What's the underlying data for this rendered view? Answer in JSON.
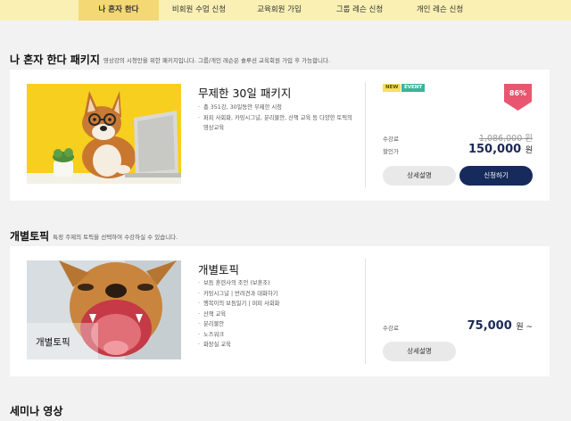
{
  "nav": {
    "tabs": [
      {
        "label": "나 혼자 한다"
      },
      {
        "label": "비회원 수업 신청"
      },
      {
        "label": "교육회원 가입"
      },
      {
        "label": "그룹 레슨 신청"
      },
      {
        "label": "개인 레슨 신청"
      }
    ],
    "active_tab": 0
  },
  "colors": {
    "nav_bg": "#faf0b4",
    "nav_active": "#f3d873",
    "navy": "#162a5b",
    "discount": "#e8566f",
    "badge_new": "#f6e05e",
    "badge_event": "#39b59a"
  },
  "section1": {
    "title": "나 혼자 한다 패키지",
    "subtitle": "영상강의 시청만을 위한 패키지입니다. 그룹/개인 레슨은 솔루션 교육회원 가입 후 가능합니다.",
    "product": {
      "title": "무제한 30일 패키지",
      "features": [
        "총 351강, 30일동안 무제한 시청",
        "퍼피 사회화, 카밍시그널, 분리불안, 산책 교육 등 다양한 토픽의 영상교육"
      ],
      "badges": [
        "NEW",
        "EVENT"
      ],
      "discount": "86%",
      "orig_label": "수강료",
      "orig_price": "1,086,000 원",
      "sale_label": "할인가",
      "sale_amount": "150,000",
      "sale_unit": "원",
      "detail_button": "상세설명",
      "apply_button": "신청하기"
    }
  },
  "section2": {
    "title": "개별토픽",
    "subtitle": "특정 주제의 토픽을 선택하여 수강하실 수 있습니다.",
    "product": {
      "thumb_label": "개별토픽",
      "title": "개별토픽",
      "features": [
        "보듬 훈련사의 조언 (보훈조)",
        "카밍시그널 | 반려견과 대화하기",
        "행복이의 보듬일기 | 퍼피 사회화",
        "산책 교육",
        "분리불안",
        "노즈워크",
        "화장실 교육"
      ],
      "price_label": "수강료",
      "price_amount": "75,000",
      "price_unit": "원 ~",
      "detail_button": "상세설명"
    }
  },
  "section3": {
    "title": "세미나 영상"
  }
}
